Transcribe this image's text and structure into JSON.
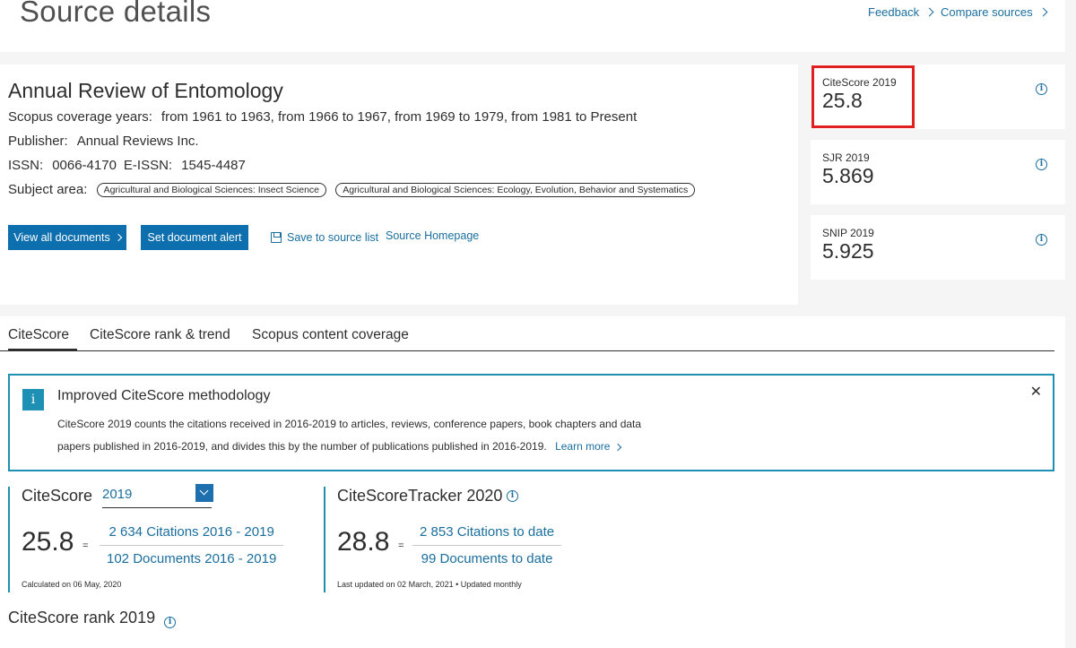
{
  "header": {
    "title": "Source details",
    "feedback_label": "Feedback",
    "compare_label": "Compare sources"
  },
  "source": {
    "title": "Annual Review of Entomology",
    "coverage_label": "Scopus coverage years:",
    "coverage_value": "from 1961 to 1963, from 1966 to 1967, from 1969 to 1979, from 1981 to Present",
    "publisher_label": "Publisher:",
    "publisher_value": "Annual Reviews Inc.",
    "issn_label": "ISSN:",
    "issn_value": "0066-4170",
    "eissn_label": "E-ISSN:",
    "eissn_value": "1545-4487",
    "subject_label": "Subject area:",
    "subjects": [
      "Agricultural and Biological Sciences: Insect Science",
      "Agricultural and Biological Sciences: Ecology, Evolution, Behavior and Systematics"
    ]
  },
  "actions": {
    "view_all": "View all documents",
    "set_alert": "Set document alert",
    "save_list": "Save to source list",
    "homepage": "Source Homepage"
  },
  "metrics": [
    {
      "label": "CiteScore 2019",
      "value": "25.8"
    },
    {
      "label": "SJR 2019",
      "value": "5.869"
    },
    {
      "label": "SNIP 2019",
      "value": "5.925"
    }
  ],
  "tabs": [
    "CiteScore",
    "CiteScore rank & trend",
    "Scopus content coverage"
  ],
  "notice": {
    "title": "Improved CiteScore methodology",
    "body_line1": "CiteScore 2019 counts the citations received in 2016-2019 to articles, reviews, conference papers, book chapters and data",
    "body_line2": "papers published in 2016-2019, and divides this by the number of publications published in 2016-2019.",
    "learn_more": "Learn more"
  },
  "citescore": {
    "title": "CiteScore",
    "year": "2019",
    "value": "25.8",
    "numerator": "2 634 Citations 2016 - 2019",
    "denominator": "102 Documents 2016 - 2019",
    "note": "Calculated on 06 May, 2020"
  },
  "tracker": {
    "title": "CiteScoreTracker 2020",
    "value": "28.8",
    "numerator": "2 853 Citations to date",
    "denominator": "99 Documents to date",
    "note": "Last updated on 02 March, 2021 • Updated monthly"
  },
  "rank": {
    "title": "CiteScore rank 2019"
  },
  "colors": {
    "accent": "#1e90b4",
    "link": "#1a6e9e",
    "button": "#0d6fae",
    "highlight": "#e02020"
  }
}
